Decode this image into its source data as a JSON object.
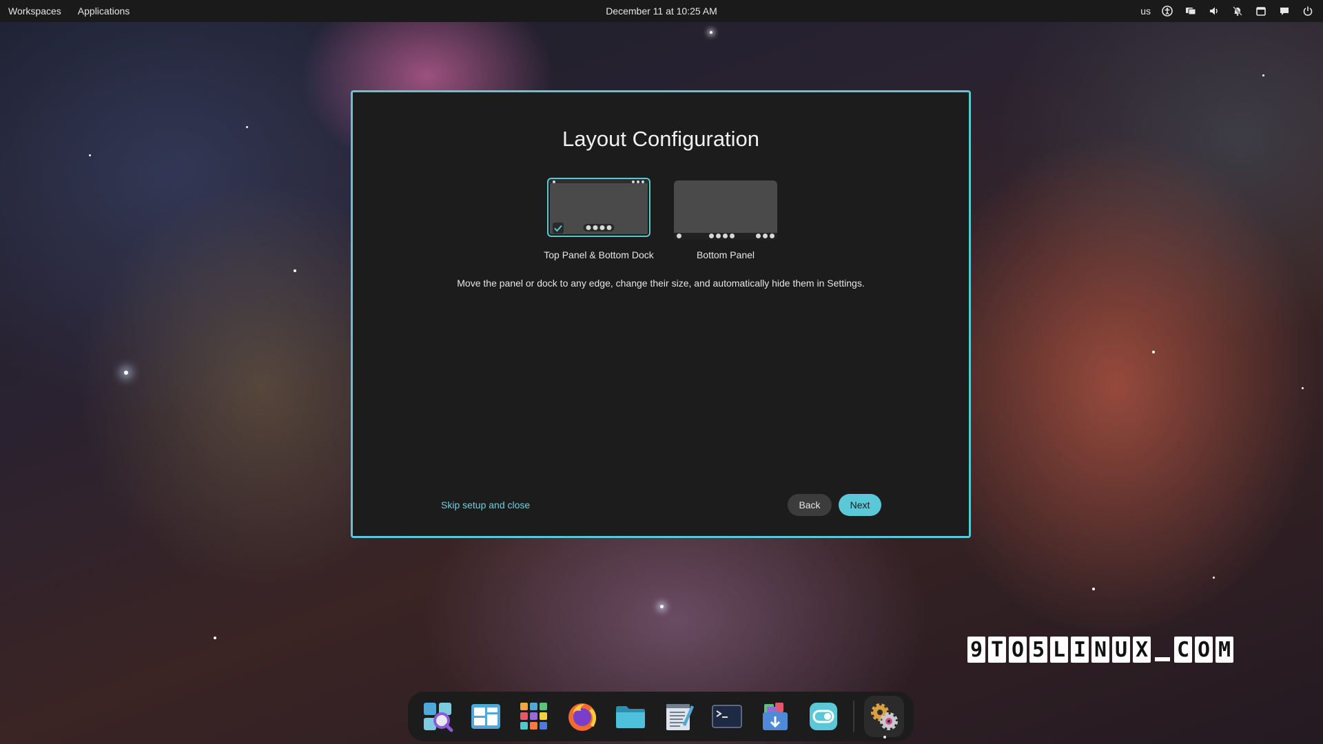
{
  "topbar": {
    "workspaces_label": "Workspaces",
    "applications_label": "Applications",
    "clock": "December 11 at 10:25 AM",
    "keyboard_layout": "us",
    "tray_icons": [
      "accessibility-icon",
      "display-icon",
      "volume-icon",
      "notifications-off-icon",
      "calendar-icon",
      "chat-icon",
      "power-icon"
    ]
  },
  "dialog": {
    "title": "Layout Configuration",
    "options": [
      {
        "label": "Top Panel & Bottom Dock",
        "selected": true
      },
      {
        "label": "Bottom Panel",
        "selected": false
      }
    ],
    "description": "Move the panel or dock to any edge, change their size, and automatically hide them in Settings.",
    "skip_label": "Skip setup and close",
    "back_label": "Back",
    "next_label": "Next"
  },
  "colors": {
    "accent": "#5bc8d8",
    "topbar_bg": "#1a1a1a",
    "dialog_bg": "#1c1c1c"
  },
  "watermark": {
    "text": "9TO5LINUX.COM"
  },
  "dock": {
    "apps": [
      {
        "name": "launcher",
        "icon": "search-launcher-icon"
      },
      {
        "name": "workspaces",
        "icon": "workspaces-icon"
      },
      {
        "name": "applications",
        "icon": "app-grid-icon"
      },
      {
        "name": "firefox",
        "icon": "firefox-icon"
      },
      {
        "name": "files",
        "icon": "folder-icon"
      },
      {
        "name": "text-editor",
        "icon": "text-editor-icon"
      },
      {
        "name": "terminal",
        "icon": "terminal-icon"
      },
      {
        "name": "store",
        "icon": "store-icon"
      },
      {
        "name": "settings",
        "icon": "settings-toggle-icon"
      },
      {
        "name": "initial-setup",
        "icon": "setup-gears-icon"
      }
    ]
  }
}
